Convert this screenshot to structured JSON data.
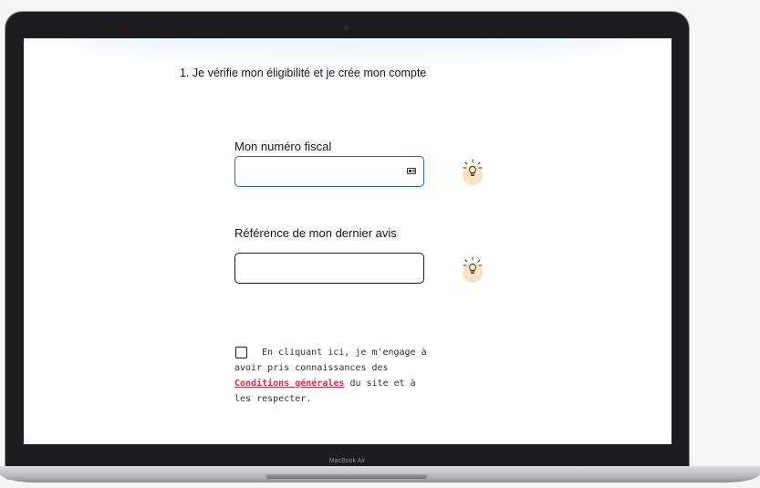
{
  "device": {
    "brand_label": "MacBook Air"
  },
  "form": {
    "step_title": "1. Je vérifie mon éligibilité et je crée mon compte",
    "fiscal_number": {
      "label": "Mon numéro fiscal",
      "value": "",
      "placeholder": ""
    },
    "notice_reference": {
      "label": "Référence de mon dernier avis",
      "value": "",
      "placeholder": ""
    },
    "consent": {
      "checked": false,
      "text_before": "En cliquant ici, je m'engage à avoir pris connaissances des",
      "link_label": "Conditions générales",
      "text_after": "du site et à les respecter."
    }
  },
  "icons": {
    "fiscal_help": "lightbulb-icon",
    "notice_help": "lightbulb-icon",
    "fiscal_field_icon": "id-card-icon"
  },
  "colors": {
    "link": "#d22c47",
    "focus_border": "#2b67c9",
    "bulb_background": "#fbe3c7"
  }
}
